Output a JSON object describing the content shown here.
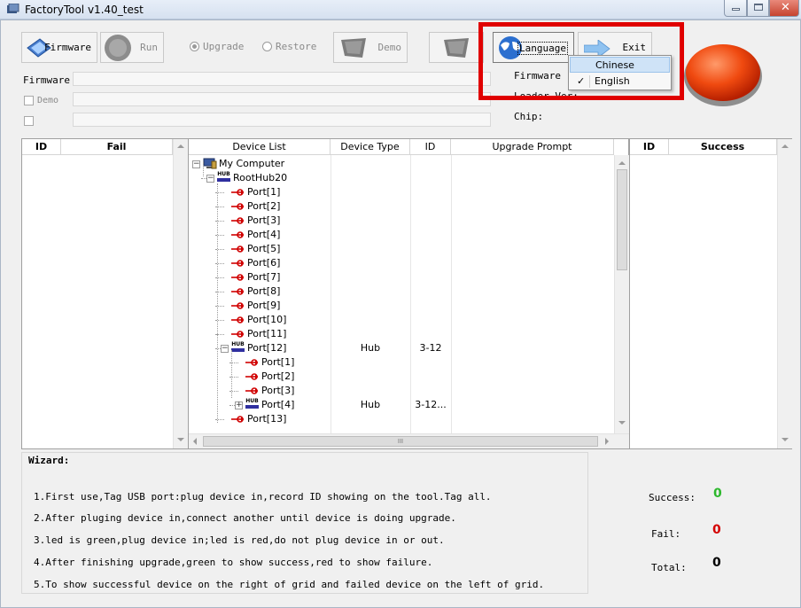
{
  "window": {
    "title": "FactoryTool v1.40_test"
  },
  "toolbar": {
    "firmware_label": "Firmware",
    "run_label": "Run",
    "upgrade_label": "Upgrade",
    "restore_label": "Restore",
    "demo_label": "Demo",
    "language_label": "Language",
    "exit_label": "Exit"
  },
  "firmware_panel": {
    "firmware_label": "Firmware",
    "demo_checkbox_label": "Demo"
  },
  "info_panel": {
    "firmware_label": "Firmware",
    "loader_label": "Loader Ver:",
    "chip_label": "Chip:"
  },
  "language_menu": {
    "items": [
      {
        "label": "Chinese",
        "checked": false,
        "highlighted": true
      },
      {
        "label": "English",
        "checked": true,
        "highlighted": false
      }
    ],
    "check_glyph": "✓"
  },
  "fail_grid": {
    "columns": [
      "ID",
      "Fail"
    ]
  },
  "success_grid": {
    "columns": [
      "ID",
      "Success"
    ]
  },
  "device_grid": {
    "columns": [
      "Device List",
      "Device Type",
      "ID",
      "Upgrade Prompt"
    ],
    "rows": [
      {
        "label": "My Computer",
        "type": "",
        "id": ""
      },
      {
        "label": "RootHub20",
        "type": "",
        "id": ""
      },
      {
        "label": "Port[1]",
        "type": "",
        "id": ""
      },
      {
        "label": "Port[2]",
        "type": "",
        "id": ""
      },
      {
        "label": "Port[3]",
        "type": "",
        "id": ""
      },
      {
        "label": "Port[4]",
        "type": "",
        "id": ""
      },
      {
        "label": "Port[5]",
        "type": "",
        "id": ""
      },
      {
        "label": "Port[6]",
        "type": "",
        "id": ""
      },
      {
        "label": "Port[7]",
        "type": "",
        "id": ""
      },
      {
        "label": "Port[8]",
        "type": "",
        "id": ""
      },
      {
        "label": "Port[9]",
        "type": "",
        "id": ""
      },
      {
        "label": "Port[10]",
        "type": "",
        "id": ""
      },
      {
        "label": "Port[11]",
        "type": "",
        "id": ""
      },
      {
        "label": "Port[12]",
        "type": "Hub",
        "id": "3-12"
      },
      {
        "label": "Port[1]",
        "type": "",
        "id": ""
      },
      {
        "label": "Port[2]",
        "type": "",
        "id": ""
      },
      {
        "label": "Port[3]",
        "type": "",
        "id": ""
      },
      {
        "label": "Port[4]",
        "type": "Hub",
        "id": "3-12..."
      },
      {
        "label": "Port[13]",
        "type": "",
        "id": ""
      }
    ],
    "hub_badge": "HUB",
    "hscroll_grip": "III"
  },
  "wizard": {
    "title": "Wizard:",
    "lines": [
      "1.First use,Tag USB port:plug device in,record ID showing on the tool.Tag all.",
      "2.After pluging device in,connect another until device is doing upgrade.",
      "3.led is green,plug device in;led is red,do not plug device in or out.",
      "4.After finishing upgrade,green to show success,red to show failure.",
      "5.To show successful device on the right of grid and failed device on the left of grid."
    ]
  },
  "stats": {
    "success_label": "Success:",
    "success_value": "0",
    "fail_label": "Fail:",
    "fail_value": "0",
    "total_label": "Total:",
    "total_value": "0"
  },
  "colors": {
    "success": "#2db82d",
    "fail": "#d40000",
    "highlight_border": "#e00000",
    "menu_highlight": "#cfe3f7"
  }
}
